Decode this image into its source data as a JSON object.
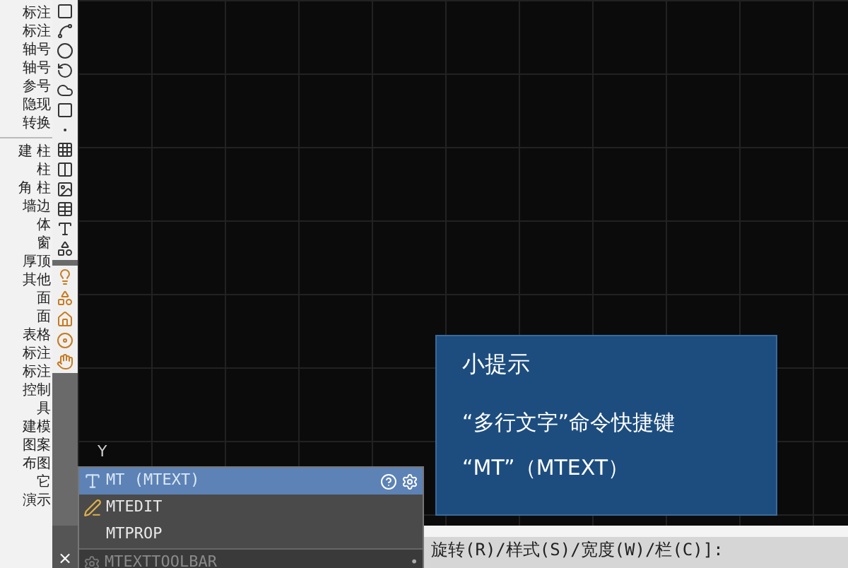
{
  "sidebar": {
    "groups": [
      [
        "标注",
        "标注",
        "轴号",
        "轴号",
        "参号",
        "隐现",
        "转换"
      ],
      [
        "建 柱",
        "柱",
        "角 柱",
        "墙边",
        "体",
        "窗",
        "厚顶",
        "其他",
        "面",
        "面",
        "表格",
        "标注",
        "标注",
        "控制",
        "具",
        "建模",
        "图案",
        "布图",
        "它",
        "演示"
      ]
    ]
  },
  "toolbar": {
    "close": "×"
  },
  "canvas": {
    "axis_label": "Y"
  },
  "tip": {
    "title": "小提示",
    "lines": [
      "“多行文字”命令快捷键",
      "“MT”（MTEXT）"
    ]
  },
  "autocomplete": {
    "items": [
      {
        "label": "MT (MTEXT)",
        "kind": "text",
        "selected": true
      },
      {
        "label": "MTEDIT",
        "kind": "edit",
        "selected": false
      },
      {
        "label": "MTPROP",
        "kind": "none",
        "selected": false
      }
    ],
    "footer": "MTEXTTOOLBAR",
    "footer_mark": "•"
  },
  "command_line": {
    "prompt": "旋转(R)/样式(S)/宽度(W)/栏(C)]:"
  }
}
